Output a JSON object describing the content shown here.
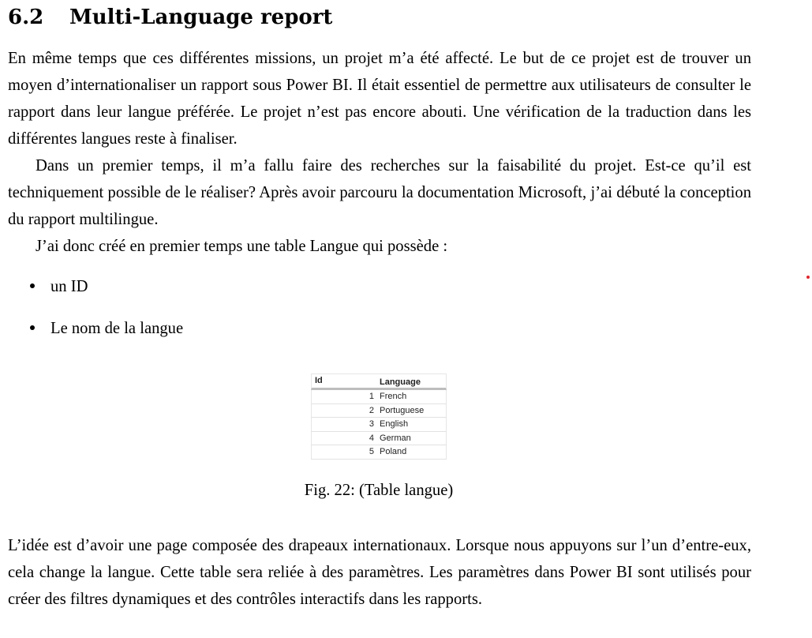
{
  "section": {
    "number": "6.2",
    "title": "Multi-Language report"
  },
  "paragraphs": [
    "En même temps que ces différentes missions, un projet m’a été affecté. Le but de ce projet est de trouver un moyen d’internationaliser un rapport sous Power BI. Il était essentiel de permettre aux utilisateurs de consulter le rapport dans leur langue préférée. Le projet n’est pas encore abouti. Une vérification de la traduction dans les différentes langues reste à finaliser.",
    "Dans un premier temps, il m’a fallu faire des recherches sur la faisabilité du projet. Est-ce qu’il est techniquement possible de le réaliser? Après avoir parcouru la documentation Microsoft, j’ai débuté la conception du rapport multilingue.",
    "J’ai donc créé en premier temps une table Langue qui possède :",
    "L’idée est d’avoir une page composée des drapeaux internationaux. Lorsque nous appuyons sur l’un d’entre-eux, cela change la langue. Cette table sera reliée à des paramètres. Les paramètres dans Power BI sont utilisés pour créer des filtres dynamiques et des contrôles interactifs dans les rapports."
  ],
  "bullets": [
    "un ID",
    "Le nom de la langue"
  ],
  "figure": {
    "headers": [
      "Id",
      "Language"
    ],
    "rows": [
      {
        "id": "1",
        "language": "French"
      },
      {
        "id": "2",
        "language": "Portuguese"
      },
      {
        "id": "3",
        "language": "English"
      },
      {
        "id": "4",
        "language": "German"
      },
      {
        "id": "5",
        "language": "Poland"
      }
    ],
    "caption": "Fig. 22: (Table langue)"
  },
  "colors": {
    "text": "#000000",
    "table_header_rule": "#bdbdbd",
    "margin_mark": "#e0262e"
  }
}
